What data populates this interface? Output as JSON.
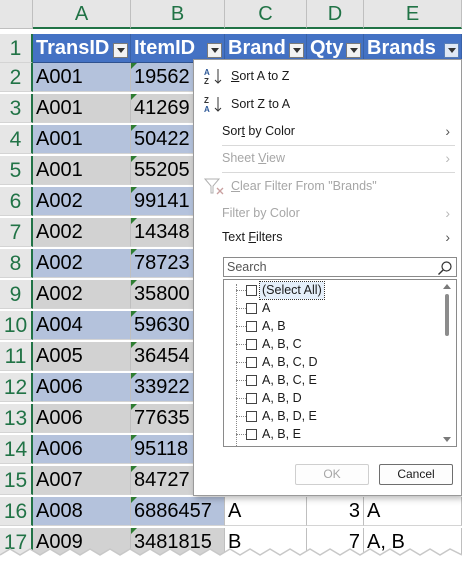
{
  "columns": [
    "A",
    "B",
    "C",
    "D",
    "E"
  ],
  "header_row": {
    "row_number": "1",
    "cells": [
      "TransID",
      "ItemID",
      "Brand",
      "Qty",
      "Brands"
    ]
  },
  "rows": [
    {
      "n": "2",
      "trans": "A001",
      "item": "19562",
      "brand": "",
      "qty": "",
      "brands": ""
    },
    {
      "n": "3",
      "trans": "A001",
      "item": "41269",
      "brand": "",
      "qty": "",
      "brands": ""
    },
    {
      "n": "4",
      "trans": "A001",
      "item": "50422",
      "brand": "",
      "qty": "",
      "brands": ""
    },
    {
      "n": "5",
      "trans": "A001",
      "item": "55205",
      "brand": "",
      "qty": "",
      "brands": ""
    },
    {
      "n": "6",
      "trans": "A002",
      "item": "99141",
      "brand": "",
      "qty": "",
      "brands": ""
    },
    {
      "n": "7",
      "trans": "A002",
      "item": "14348",
      "brand": "",
      "qty": "",
      "brands": ""
    },
    {
      "n": "8",
      "trans": "A002",
      "item": "78723",
      "brand": "",
      "qty": "",
      "brands": ""
    },
    {
      "n": "9",
      "trans": "A002",
      "item": "35800",
      "brand": "",
      "qty": "",
      "brands": ""
    },
    {
      "n": "10",
      "trans": "A004",
      "item": "59630",
      "brand": "",
      "qty": "",
      "brands": ""
    },
    {
      "n": "11",
      "trans": "A005",
      "item": "36454",
      "brand": "",
      "qty": "",
      "brands": ""
    },
    {
      "n": "12",
      "trans": "A006",
      "item": "33922",
      "brand": "",
      "qty": "",
      "brands": ""
    },
    {
      "n": "13",
      "trans": "A006",
      "item": "77635",
      "brand": "",
      "qty": "",
      "brands": ""
    },
    {
      "n": "14",
      "trans": "A006",
      "item": "95118",
      "brand": "",
      "qty": "",
      "brands": ""
    },
    {
      "n": "15",
      "trans": "A007",
      "item": "84727",
      "brand": "",
      "qty": "",
      "brands": ""
    },
    {
      "n": "16",
      "trans": "A008",
      "item": "6886457",
      "brand": "A",
      "qty": "3",
      "brands": "A"
    },
    {
      "n": "17",
      "trans": "A009",
      "item": "3481815",
      "brand": "B",
      "qty": "7",
      "brands": "A, B"
    }
  ],
  "menu": {
    "sort_az": "Sort A to Z",
    "sort_za": "Sort Z to A",
    "sort_by_color": "Sort by Color",
    "sheet_view": "Sheet View",
    "clear_filter": "Clear Filter From \"Brands\"",
    "filter_by_color": "Filter by Color",
    "text_filters": "Text Filters",
    "search_placeholder": "Search",
    "list_items": [
      {
        "label": "(Select All)",
        "checked": false
      },
      {
        "label": "A",
        "checked": false
      },
      {
        "label": "A, B",
        "checked": false
      },
      {
        "label": "A, B, C",
        "checked": false
      },
      {
        "label": "A, B, C, D",
        "checked": false
      },
      {
        "label": "A, B, C, E",
        "checked": false
      },
      {
        "label": "A, B, D",
        "checked": false
      },
      {
        "label": "A, B, D, E",
        "checked": false
      },
      {
        "label": "A, B, E",
        "checked": false
      }
    ],
    "ok": "OK",
    "cancel": "Cancel"
  },
  "icons": {
    "sort_az": "sort-ascending-icon",
    "sort_za": "sort-descending-icon",
    "clear_filter": "clear-filter-icon",
    "search": "magnifier-icon",
    "submenu": "chevron-right-icon",
    "filter": "filter-dropdown-icon"
  },
  "colors": {
    "header_fill": "#4472c4",
    "band_blue": "#b4c2dc",
    "band_gray": "#d2d2d2",
    "excel_green": "#217346"
  }
}
